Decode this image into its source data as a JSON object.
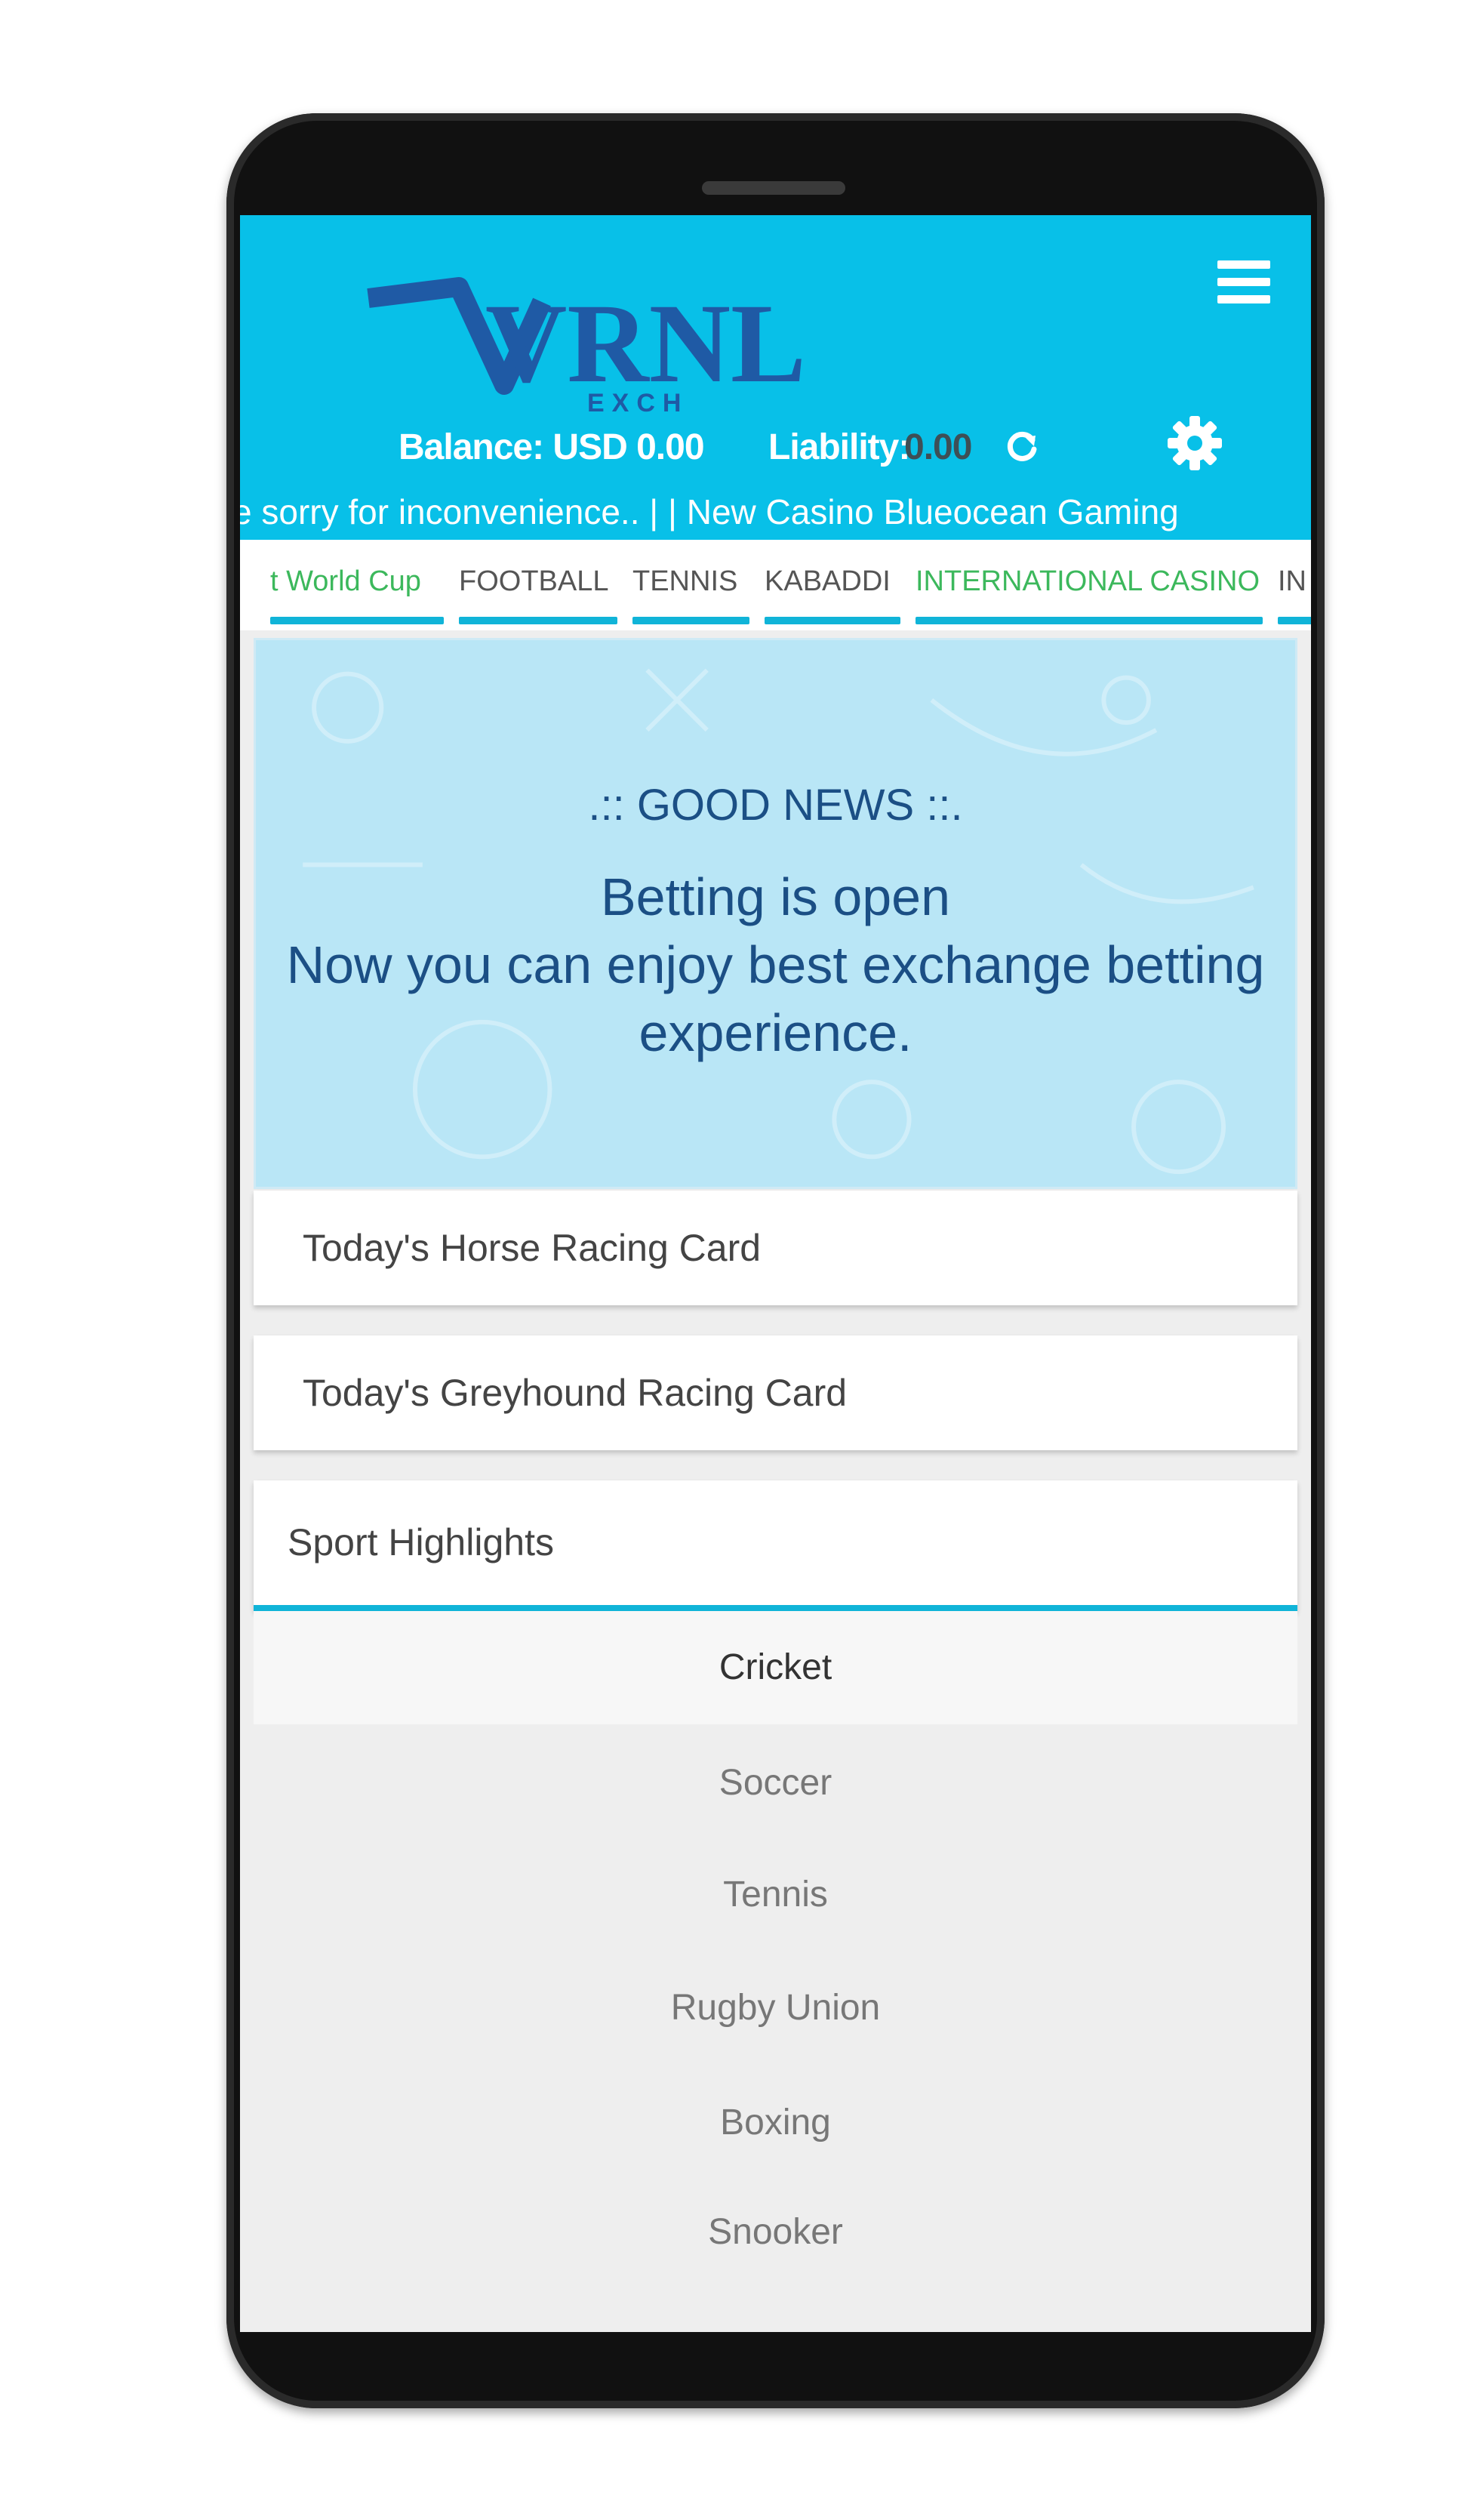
{
  "header": {
    "logo_text": "VRNL",
    "logo_sub": "EXCH",
    "balance": "Balance: USD 0.00",
    "liability_label": "Liability:",
    "liability_value": "0.00",
    "marquee": "e sorry for inconvenience.. | | New Casino Blueocean Gaming"
  },
  "tabs": [
    {
      "label": "t World Cup",
      "style": "green"
    },
    {
      "label": "FOOTBALL",
      "style": "normal"
    },
    {
      "label": "TENNIS",
      "style": "normal"
    },
    {
      "label": "KABADDI",
      "style": "normal"
    },
    {
      "label": "INTERNATIONAL CASINO",
      "style": "green"
    },
    {
      "label": "IN",
      "style": "normal"
    }
  ],
  "banner": {
    "title": ".:: GOOD NEWS ::.",
    "line1": "Betting is open",
    "line2": "Now you can enjoy best exchange betting",
    "line3": "experience."
  },
  "cards": {
    "horse": "Today's Horse Racing Card",
    "greyhound": "Today's Greyhound Racing Card",
    "highlights": "Sport Highlights"
  },
  "sports": [
    "Cricket",
    "Soccer",
    "Tennis",
    "Rugby Union",
    "Boxing",
    "Snooker"
  ],
  "colors": {
    "accent": "#08c0e8",
    "underline": "#10b4d8",
    "green": "#3cb85c",
    "text_blue": "#1b4f85"
  }
}
